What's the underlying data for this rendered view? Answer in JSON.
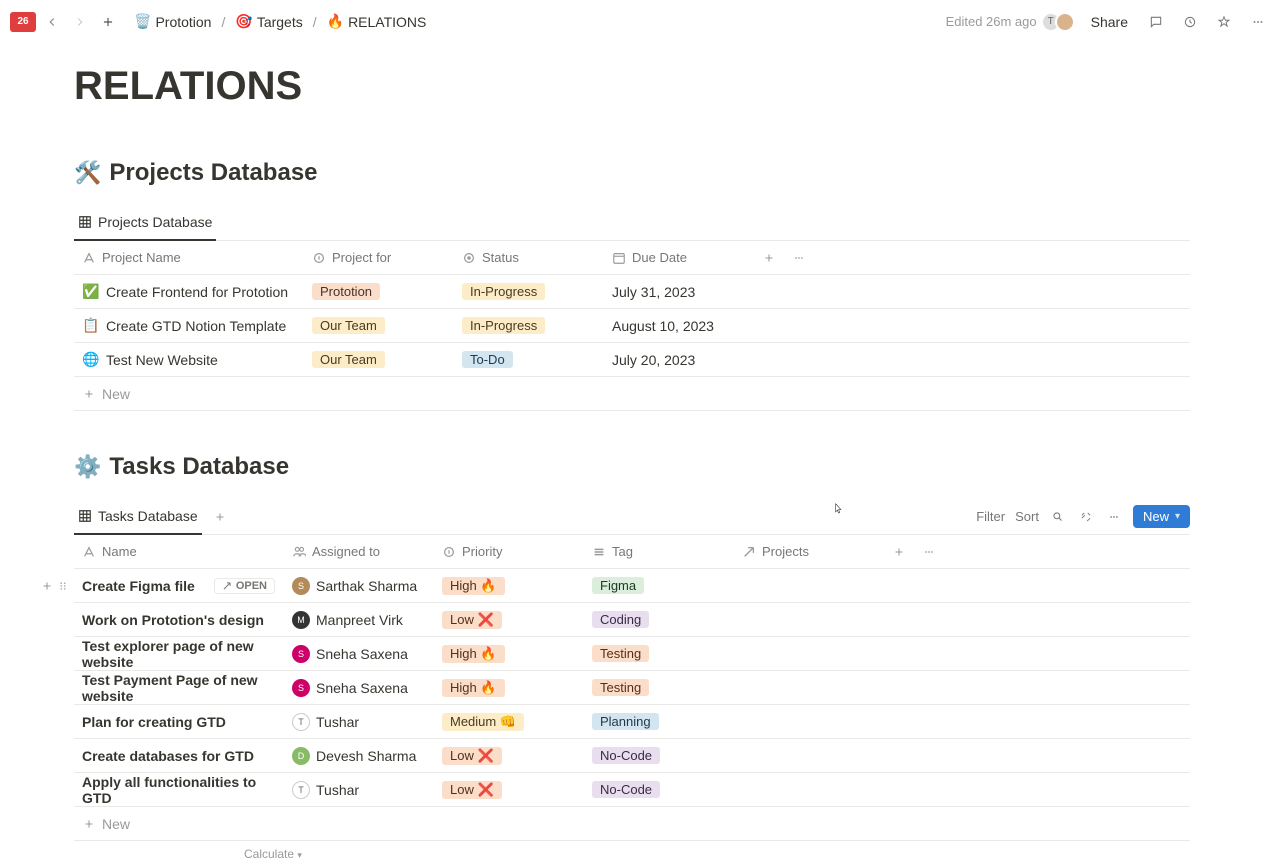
{
  "topbar": {
    "app_badge": "26",
    "breadcrumb": [
      {
        "icon": "🗑️",
        "label": "Prototion"
      },
      {
        "icon": "🎯",
        "label": "Targets"
      },
      {
        "icon": "🔥",
        "label": "RELATIONS"
      }
    ],
    "edited": "Edited 26m ago",
    "share": "Share"
  },
  "page": {
    "title": "RELATIONS"
  },
  "projects": {
    "heading_emoji": "🛠️",
    "heading": "Projects Database",
    "view_tab": "Projects Database",
    "columns": {
      "name": "Project Name",
      "for": "Project for",
      "status": "Status",
      "due": "Due Date"
    },
    "rows": [
      {
        "icon": "✅",
        "name": "Create Frontend for Prototion",
        "for": "Prototion",
        "for_class": "pill-prototion",
        "status": "In-Progress",
        "status_class": "pill-inprogress",
        "due": "July 31, 2023"
      },
      {
        "icon": "📋",
        "name": "Create GTD Notion Template",
        "for": "Our Team",
        "for_class": "pill-ourteam",
        "status": "In-Progress",
        "status_class": "pill-inprogress",
        "due": "August 10, 2023"
      },
      {
        "icon": "🌐",
        "name": "Test New Website",
        "for": "Our Team",
        "for_class": "pill-ourteam",
        "status": "To-Do",
        "status_class": "pill-todo",
        "due": "July 20, 2023"
      }
    ],
    "new_row": "New"
  },
  "tasks": {
    "heading_emoji": "⚙️",
    "heading": "Tasks Database",
    "view_tab": "Tasks Database",
    "toolbar": {
      "filter": "Filter",
      "sort": "Sort",
      "new": "New"
    },
    "columns": {
      "name": "Name",
      "assigned": "Assigned to",
      "priority": "Priority",
      "tag": "Tag",
      "projects": "Projects"
    },
    "rows": [
      {
        "name": "Create Figma file",
        "assignee": "Sarthak Sharma",
        "av": "S",
        "av_bg": "#b38b59",
        "priority": "High 🔥",
        "priority_class": "pill-high",
        "tag": "Figma",
        "tag_class": "pill-figma",
        "open": true
      },
      {
        "name": "Work on Prototion's design",
        "assignee": "Manpreet Virk",
        "av": "M",
        "av_bg": "#333",
        "priority": "Low ❌",
        "priority_class": "pill-low",
        "tag": "Coding",
        "tag_class": "pill-coding"
      },
      {
        "name": "Test explorer page of new website",
        "assignee": "Sneha Saxena",
        "av": "S",
        "av_bg": "#c06",
        "priority": "High 🔥",
        "priority_class": "pill-high",
        "tag": "Testing",
        "tag_class": "pill-testing"
      },
      {
        "name": "Test Payment Page of new website",
        "assignee": "Sneha Saxena",
        "av": "S",
        "av_bg": "#c06",
        "priority": "High 🔥",
        "priority_class": "pill-high",
        "tag": "Testing",
        "tag_class": "pill-testing"
      },
      {
        "name": "Plan for creating GTD",
        "assignee": "Tushar",
        "av": "T",
        "av_bg": "initial",
        "priority": "Medium 👊",
        "priority_class": "pill-medium",
        "tag": "Planning",
        "tag_class": "pill-planning"
      },
      {
        "name": "Create databases for GTD",
        "assignee": "Devesh Sharma",
        "av": "D",
        "av_bg": "#8b6",
        "priority": "Low ❌",
        "priority_class": "pill-low",
        "tag": "No-Code",
        "tag_class": "pill-nocode"
      },
      {
        "name": "Apply all functionalities to GTD",
        "assignee": "Tushar",
        "av": "T",
        "av_bg": "initial",
        "priority": "Low ❌",
        "priority_class": "pill-low",
        "tag": "No-Code",
        "tag_class": "pill-nocode"
      }
    ],
    "open_label": "OPEN",
    "new_row": "New",
    "calculate": "Calculate"
  },
  "col_widths": {
    "projects": {
      "name": 230,
      "for": 150,
      "status": 150,
      "due": 150
    },
    "tasks": {
      "name": 210,
      "assigned": 150,
      "priority": 150,
      "tag": 150,
      "projects": 150
    }
  }
}
